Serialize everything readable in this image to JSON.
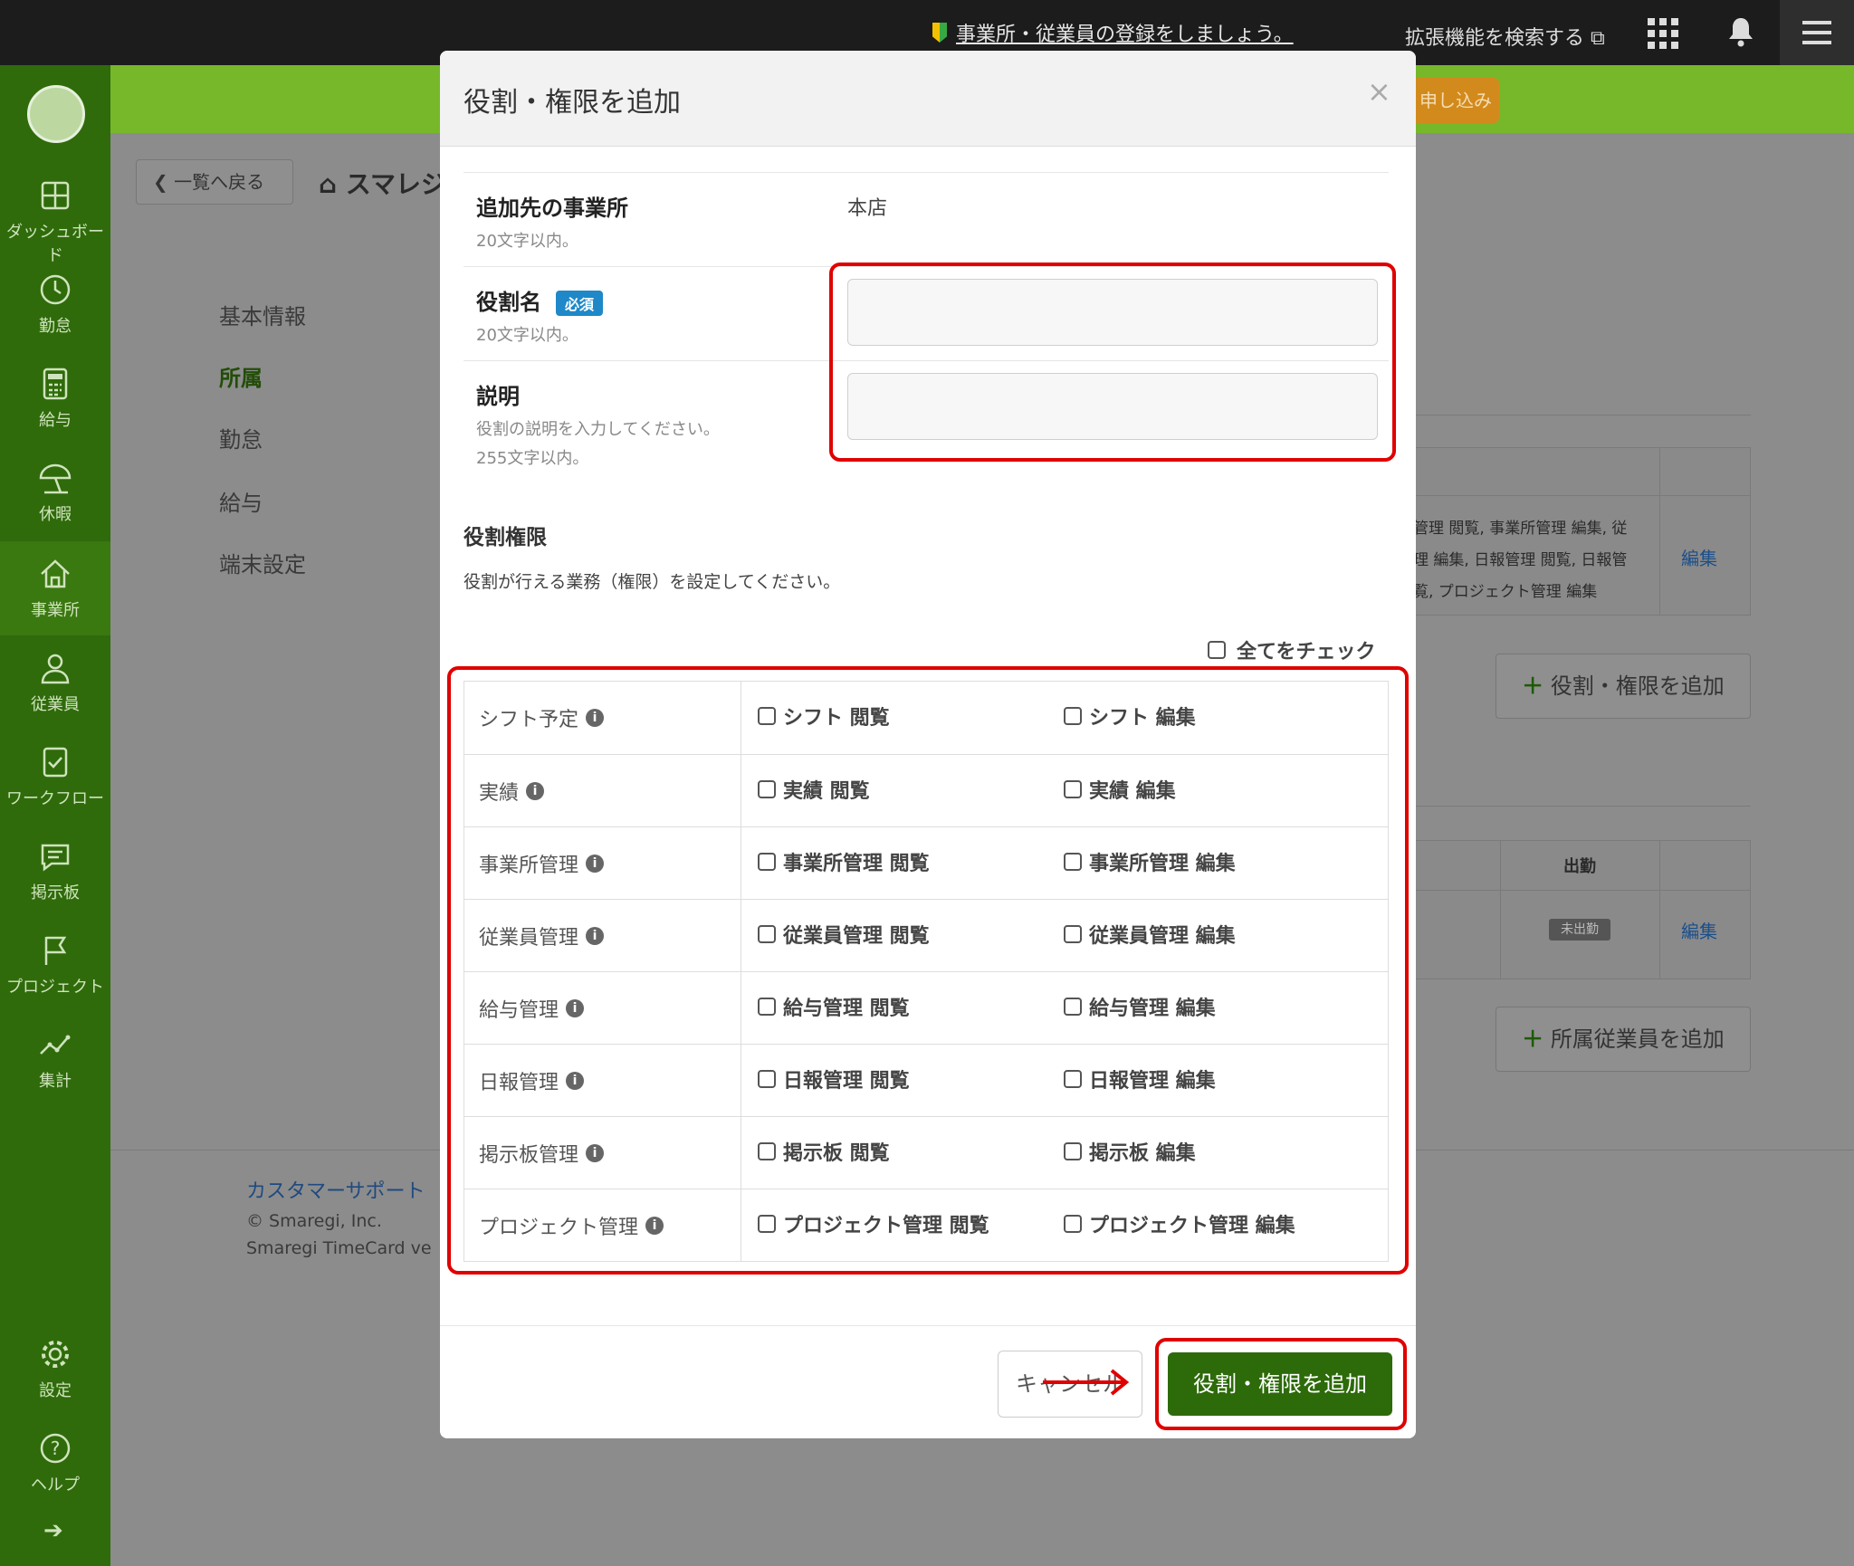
{
  "topbar": {
    "notice": "事業所・従業員の登録をしましょう。",
    "extension_search": "拡張機能を検索する ⧉",
    "grid_icon": "apps-grid-icon",
    "bell_icon": "bell-icon",
    "menu_icon": "hamburger-icon"
  },
  "sidebar": {
    "items": [
      {
        "label": "ダッシュボード",
        "icon": "dashboard-icon"
      },
      {
        "label": "勤怠",
        "icon": "clock-icon"
      },
      {
        "label": "給与",
        "icon": "calculator-icon"
      },
      {
        "label": "休暇",
        "icon": "beach-umbrella-icon"
      },
      {
        "label": "事業所",
        "icon": "home-icon"
      },
      {
        "label": "従業員",
        "icon": "person-icon"
      },
      {
        "label": "ワークフロー",
        "icon": "checklist-icon"
      },
      {
        "label": "掲示板",
        "icon": "chat-icon"
      },
      {
        "label": "プロジェクト",
        "icon": "flag-icon"
      },
      {
        "label": "集計",
        "icon": "line-chart-icon"
      }
    ],
    "settings": "設定",
    "help": "ヘルプ"
  },
  "background": {
    "banner_button": "申し込み",
    "back_button": "一覧へ戻る",
    "page_title": "スマレジ",
    "subnav": [
      "基本情報",
      "所属",
      "勤怠",
      "給与",
      "端末設定"
    ],
    "role_table_text": [
      "管理 閲覧, 事業所管理 編集, 従",
      "理 編集, 日報管理 閲覧, 日報管",
      "覧, プロジェクト管理 編集"
    ],
    "edit_link": "編集",
    "add_role_button": "役割・権限を追加",
    "attendance_header": "出勤",
    "status_badge": "未出勤",
    "add_member_button": "所属従業員を追加",
    "support_link": "カスタマーサポート",
    "copyright": "© Smaregi, Inc.",
    "version": "Smaregi TimeCard ve"
  },
  "modal": {
    "title": "役割・権限を追加",
    "close": "×",
    "office_label": "追加先の事業所",
    "office_hint": "20文字以内。",
    "office_value": "本店",
    "role_name_label": "役割名",
    "required_badge": "必須",
    "role_name_hint": "20文字以内。",
    "role_name_value": "",
    "desc_label": "説明",
    "desc_hint1": "役割の説明を入力してください。",
    "desc_hint2": "255文字以内。",
    "desc_value": "",
    "perm_title": "役割権限",
    "perm_desc": "役割が行える業務（権限）を設定してください。",
    "check_all": "全てをチェック",
    "permissions": [
      {
        "category": "シフト予定",
        "view": "シフト 閲覧",
        "edit": "シフト 編集"
      },
      {
        "category": "実績",
        "view": "実績 閲覧",
        "edit": "実績 編集"
      },
      {
        "category": "事業所管理",
        "view": "事業所管理 閲覧",
        "edit": "事業所管理 編集"
      },
      {
        "category": "従業員管理",
        "view": "従業員管理 閲覧",
        "edit": "従業員管理 編集"
      },
      {
        "category": "給与管理",
        "view": "給与管理 閲覧",
        "edit": "給与管理 編集"
      },
      {
        "category": "日報管理",
        "view": "日報管理 閲覧",
        "edit": "日報管理 編集"
      },
      {
        "category": "掲示板管理",
        "view": "掲示板 閲覧",
        "edit": "掲示板 編集"
      },
      {
        "category": "プロジェクト管理",
        "view": "プロジェクト管理 閲覧",
        "edit": "プロジェクト管理 編集"
      }
    ],
    "cancel_button": "キャンセル",
    "submit_button": "役割・権限を追加"
  },
  "colors": {
    "sidebar": "#2f6b0b",
    "banner": "#76b82a",
    "primary_button": "#2d6a0a",
    "highlight": "#e00000",
    "required_badge": "#1e88c8"
  }
}
